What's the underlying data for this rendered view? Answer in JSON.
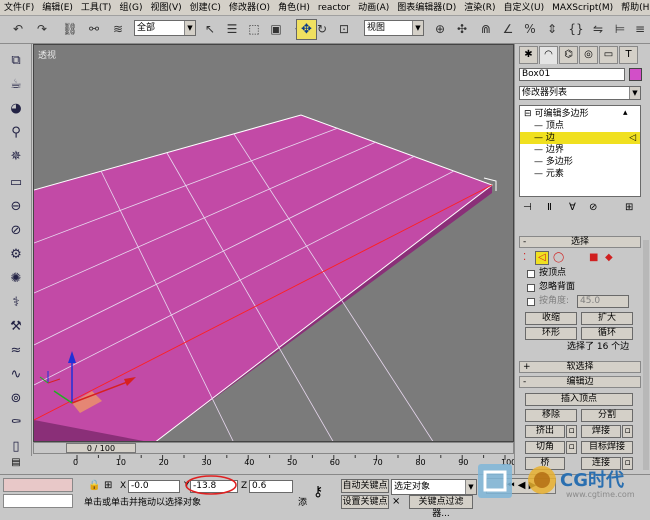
{
  "menu": [
    "文件(F)",
    "编辑(E)",
    "工具(T)",
    "组(G)",
    "视图(V)",
    "创建(C)",
    "修改器(O)",
    "角色(H)",
    "reactor",
    "动画(A)",
    "图表编辑器(D)",
    "渲染(R)",
    "自定义(U)",
    "MAXScript(M)",
    "帮助(H)"
  ],
  "toolbar": {
    "selection_filter": "全部",
    "ref_coord": "视图"
  },
  "viewport": {
    "label": "透视",
    "object_color": "#c24aa6"
  },
  "timeslider": {
    "position": "0 / 100"
  },
  "ruler_ticks": [
    "0",
    "10",
    "20",
    "30",
    "40",
    "50",
    "60",
    "70",
    "80",
    "90",
    "100"
  ],
  "status": {
    "x_label": "X",
    "x_value": "-0.0",
    "y_label": "Y",
    "y_value": "-13.8",
    "z_label": "Z",
    "z_value": "0.6",
    "prompt": "单击或单击并拖动以选择对象",
    "add_label": "添",
    "auto_key": "自动关键点",
    "set_key": "设置关键点",
    "selected_objects": "选定对象",
    "key_filters": "关键点过滤器..."
  },
  "panel": {
    "object_name": "Box01",
    "object_color": "#d24fc8",
    "modifier_list": "修改器列表",
    "stack": [
      {
        "label": "可编辑多边形",
        "level": 0,
        "expand": "⊟"
      },
      {
        "label": "顶点",
        "level": 1
      },
      {
        "label": "边",
        "level": 1,
        "selected": true
      },
      {
        "label": "边界",
        "level": 1
      },
      {
        "label": "多边形",
        "level": 1
      },
      {
        "label": "元素",
        "level": 1
      }
    ],
    "selection_rollout": {
      "title": "选择",
      "by_vertex": "按顶点",
      "ignore_backfacing": "忽略背面",
      "by_angle": "按角度:",
      "angle_value": "45.0",
      "shrink": "收缩",
      "grow": "扩大",
      "ring": "环形",
      "loop": "循环",
      "selection_info": "选择了 16 个边"
    },
    "soft_selection_title": "软选择",
    "edit_edges": {
      "title": "编辑边",
      "insert_vertex": "插入顶点",
      "remove": "移除",
      "split": "分割",
      "extrude": "挤出",
      "weld": "焊接",
      "chamfer": "切角",
      "target_weld": "目标焊接",
      "bridge": "桥",
      "connect": "连接"
    }
  },
  "watermark": {
    "brand": "CG时代",
    "url": "www.cgtime.com"
  }
}
